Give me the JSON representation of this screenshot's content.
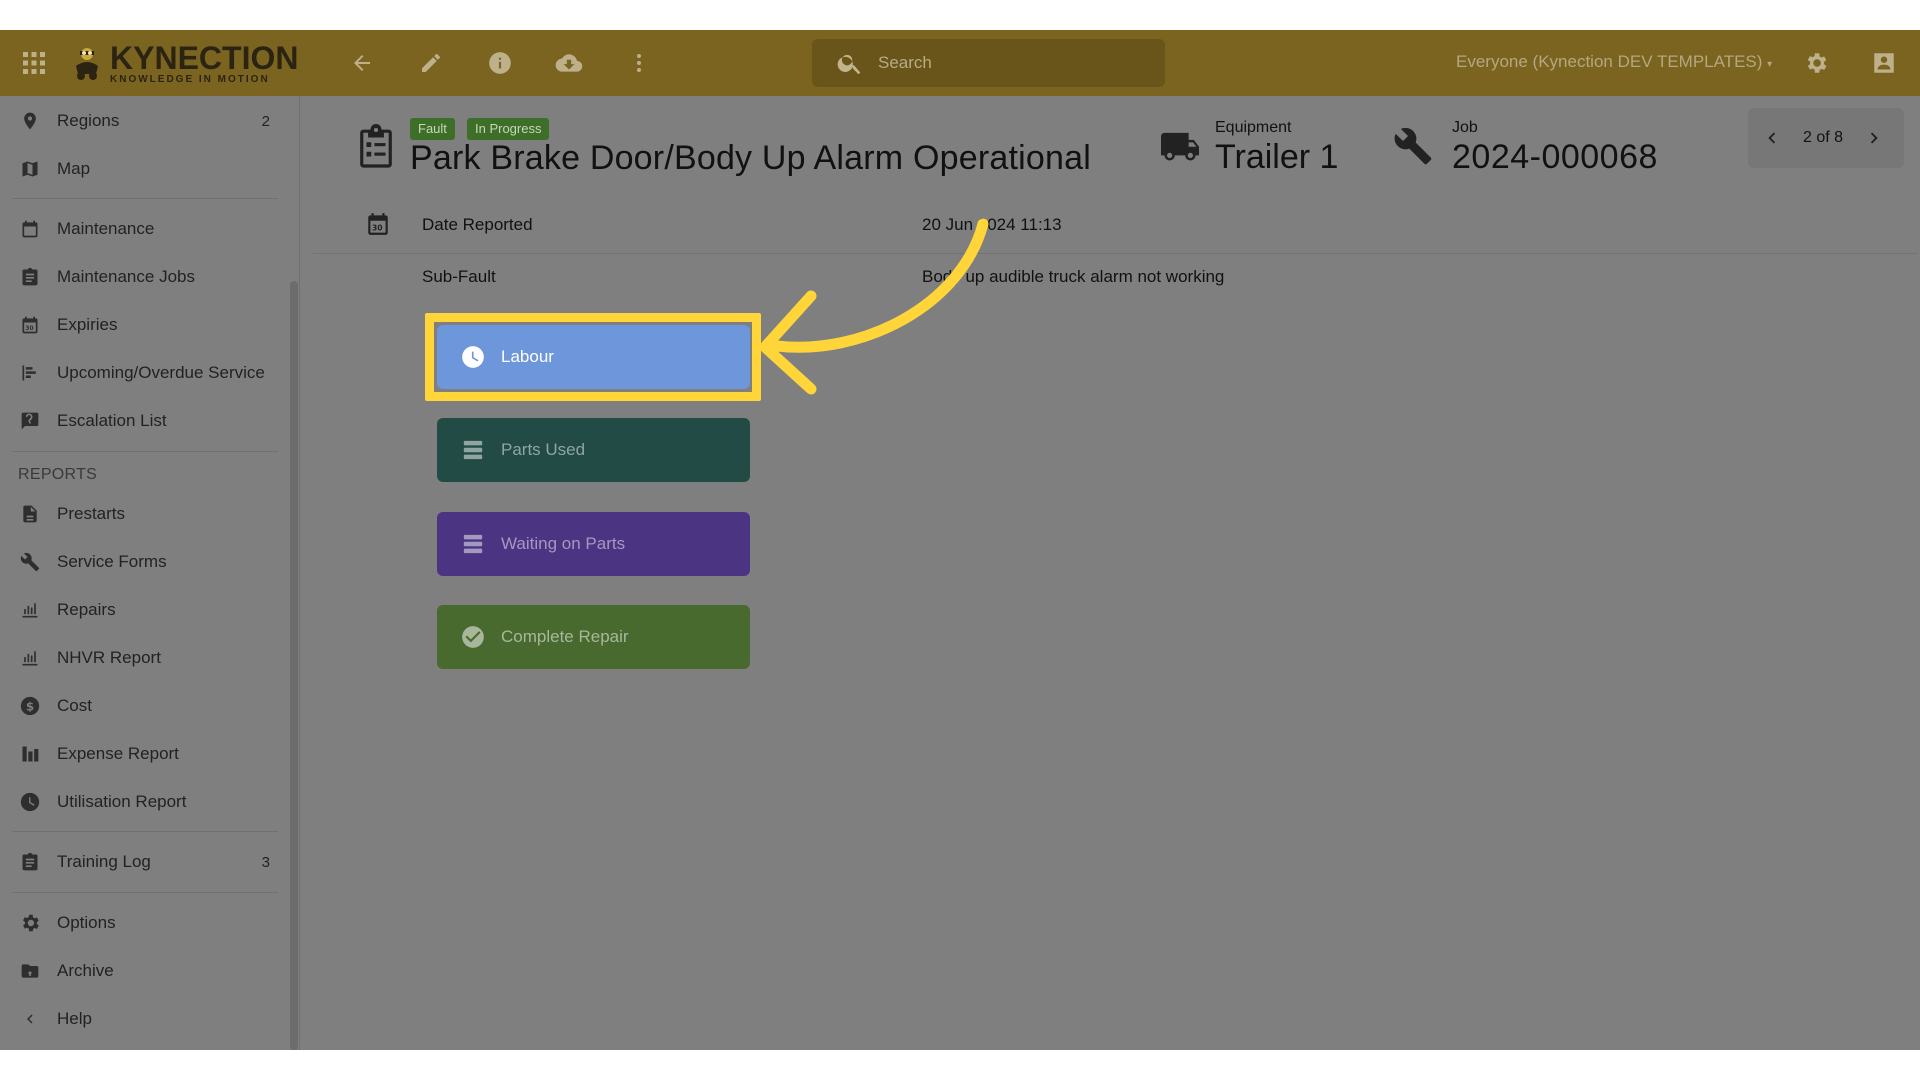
{
  "topbar": {
    "brand_name": "KYNECTION",
    "brand_tagline": "KNOWLEDGE IN MOTION",
    "search_placeholder": "Search",
    "org_selector": "Everyone (Kynection DEV TEMPLATES)",
    "icons": [
      "apps-icon",
      "back-arrow-icon",
      "edit-pencil-icon",
      "info-icon",
      "cloud-download-icon",
      "more-vert-icon",
      "search-icon",
      "settings-gear-icon",
      "account-icon"
    ]
  },
  "sidebar": {
    "items": [
      {
        "label": "Regions",
        "count": "2",
        "icon": "location-pin-icon"
      },
      {
        "label": "Map",
        "icon": "map-icon"
      },
      {
        "label": "Maintenance",
        "icon": "calendar-icon"
      },
      {
        "label": "Maintenance Jobs",
        "icon": "clipboard-icon"
      },
      {
        "label": "Expiries",
        "icon": "calendar-30-icon"
      },
      {
        "label": "Upcoming/Overdue Service",
        "icon": "timeline-icon"
      },
      {
        "label": "Escalation List",
        "icon": "report-question-icon"
      }
    ],
    "reports_section_label": "REPORTS",
    "report_items": [
      {
        "label": "Prestarts",
        "icon": "document-icon"
      },
      {
        "label": "Service Forms",
        "icon": "wrench-icon"
      },
      {
        "label": "Repairs",
        "icon": "chart-icon"
      },
      {
        "label": "NHVR Report",
        "icon": "chart-icon"
      },
      {
        "label": "Cost",
        "icon": "dollar-icon"
      },
      {
        "label": "Expense Report",
        "icon": "bar-chart-icon"
      },
      {
        "label": "Utilisation Report",
        "icon": "clock-icon"
      }
    ],
    "training": {
      "label": "Training Log",
      "count": "3",
      "icon": "clipboard-icon"
    },
    "bottom_items": [
      {
        "label": "Options",
        "icon": "gear-icon"
      },
      {
        "label": "Archive",
        "icon": "archive-icon"
      },
      {
        "label": "Help",
        "icon": "chevron-left-icon"
      }
    ]
  },
  "job": {
    "tags": [
      "Fault",
      "In Progress"
    ],
    "title": "Park Brake Door/Body Up Alarm Operational",
    "equipment_label": "Equipment",
    "equipment_value": "Trailer 1",
    "job_label": "Job",
    "job_value": "2024-000068",
    "pager": "2 of 8"
  },
  "details": {
    "date_reported_label": "Date Reported",
    "date_reported_value": "20 Jun 2024 11:13",
    "subfault_label": "Sub-Fault",
    "subfault_value": "Body up audible truck alarm not working"
  },
  "actions": {
    "labour": "Labour",
    "parts_used": "Parts Used",
    "waiting_on_parts": "Waiting on Parts",
    "complete_repair": "Complete Repair"
  },
  "colors": {
    "topbar": "#7b6420",
    "labour_button": "#6e96db",
    "parts_button": "#224b45",
    "waiting_button": "#4b3481",
    "complete_button": "#486a2f",
    "highlight": "#ffd53a",
    "tag": "#3d6f29"
  }
}
